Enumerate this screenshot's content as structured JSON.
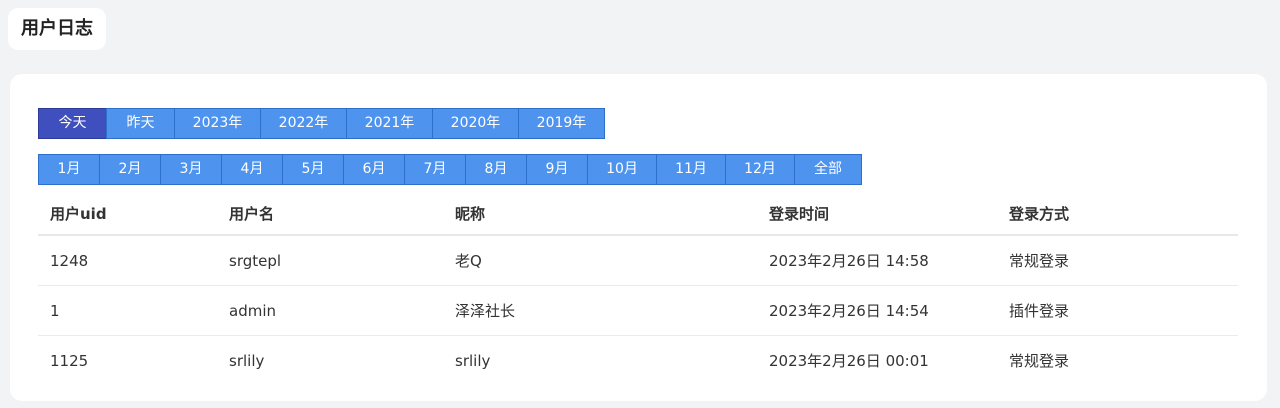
{
  "page": {
    "title": "用户日志"
  },
  "filters": {
    "years": [
      "今天",
      "昨天",
      "2023年",
      "2022年",
      "2021年",
      "2020年",
      "2019年"
    ],
    "active_year_index": 0,
    "months": [
      "1月",
      "2月",
      "3月",
      "4月",
      "5月",
      "6月",
      "7月",
      "8月",
      "9月",
      "10月",
      "11月",
      "12月",
      "全部"
    ]
  },
  "table": {
    "headers": [
      "用户uid",
      "用户名",
      "昵称",
      "登录时间",
      "登录方式"
    ],
    "rows": [
      {
        "uid": "1248",
        "username": "srgtepl",
        "nickname": "老Q",
        "login_time": "2023年2月26日 14:58",
        "login_method": "常规登录",
        "plugin": false
      },
      {
        "uid": "1",
        "username": "admin",
        "nickname": "泽泽社长",
        "login_time": "2023年2月26日 14:54",
        "login_method": "插件登录",
        "plugin": true
      },
      {
        "uid": "1125",
        "username": "srlily",
        "nickname": "srlily",
        "login_time": "2023年2月26日 00:01",
        "login_method": "常规登录",
        "plugin": false
      }
    ]
  },
  "colors": {
    "button": "#4e93ed",
    "button_active": "#3f4fbd",
    "plugin_method": "#d9342b"
  }
}
